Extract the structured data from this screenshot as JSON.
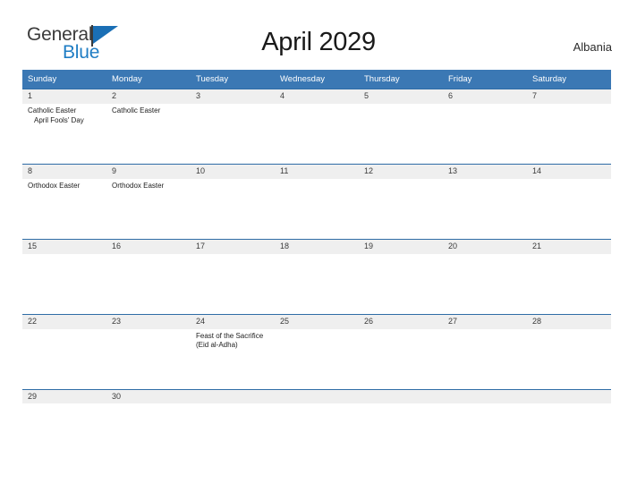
{
  "branding": {
    "name_part1": "General",
    "name_part2": "Blue",
    "flag_icon": "flag-triangle-icon",
    "color_primary": "#1f7dc4",
    "color_text": "#3b3b3b"
  },
  "header": {
    "title": "April 2029",
    "country": "Albania"
  },
  "theme": {
    "header_blue": "#3b78b4",
    "row_border_blue": "#2e6ca6",
    "date_band_gray": "#efefef",
    "page_background": "#ffffff"
  },
  "calendar": {
    "month": "April",
    "year": "2029",
    "weekday_headers": [
      "Sunday",
      "Monday",
      "Tuesday",
      "Wednesday",
      "Thursday",
      "Friday",
      "Saturday"
    ],
    "weeks": [
      {
        "height": "tall",
        "days": [
          {
            "date": "1",
            "events": [
              {
                "text": "Catholic Easter",
                "indented": false
              },
              {
                "text": "April Fools' Day",
                "indented": true
              }
            ]
          },
          {
            "date": "2",
            "events": [
              {
                "text": "Catholic Easter",
                "indented": false
              }
            ]
          },
          {
            "date": "3",
            "events": []
          },
          {
            "date": "4",
            "events": []
          },
          {
            "date": "5",
            "events": []
          },
          {
            "date": "6",
            "events": []
          },
          {
            "date": "7",
            "events": []
          }
        ]
      },
      {
        "height": "mid",
        "days": [
          {
            "date": "8",
            "events": [
              {
                "text": "Orthodox Easter",
                "indented": false
              }
            ]
          },
          {
            "date": "9",
            "events": [
              {
                "text": "Orthodox Easter",
                "indented": false
              }
            ]
          },
          {
            "date": "10",
            "events": []
          },
          {
            "date": "11",
            "events": []
          },
          {
            "date": "12",
            "events": []
          },
          {
            "date": "13",
            "events": []
          },
          {
            "date": "14",
            "events": []
          }
        ]
      },
      {
        "height": "mid",
        "days": [
          {
            "date": "15",
            "events": []
          },
          {
            "date": "16",
            "events": []
          },
          {
            "date": "17",
            "events": []
          },
          {
            "date": "18",
            "events": []
          },
          {
            "date": "19",
            "events": []
          },
          {
            "date": "20",
            "events": []
          },
          {
            "date": "21",
            "events": []
          }
        ]
      },
      {
        "height": "mid",
        "days": [
          {
            "date": "22",
            "events": []
          },
          {
            "date": "23",
            "events": []
          },
          {
            "date": "24",
            "events": [
              {
                "text": "Feast of the Sacrifice (Eid al-Adha)",
                "indented": false
              }
            ]
          },
          {
            "date": "25",
            "events": []
          },
          {
            "date": "26",
            "events": []
          },
          {
            "date": "27",
            "events": []
          },
          {
            "date": "28",
            "events": []
          }
        ]
      },
      {
        "height": "short",
        "days": [
          {
            "date": "29",
            "events": []
          },
          {
            "date": "30",
            "events": []
          },
          {
            "date": "",
            "events": []
          },
          {
            "date": "",
            "events": []
          },
          {
            "date": "",
            "events": []
          },
          {
            "date": "",
            "events": []
          },
          {
            "date": "",
            "events": []
          }
        ]
      }
    ]
  }
}
